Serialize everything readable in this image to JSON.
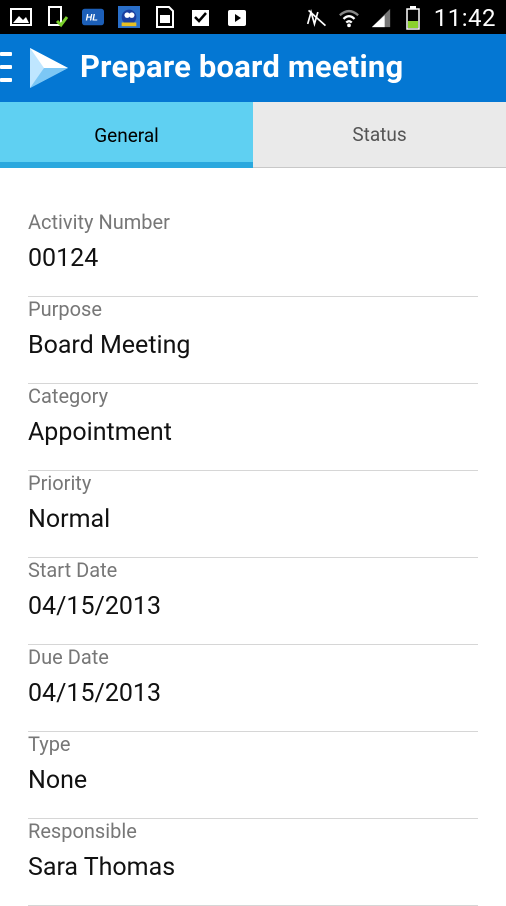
{
  "statusbar": {
    "time": "11:42",
    "icons": [
      "image-icon",
      "download-check-icon",
      "hl-app-icon",
      "sonic-app-icon",
      "sim-card-icon",
      "checkbox-icon",
      "play-store-icon"
    ],
    "right_icons": [
      "no-sound-icon",
      "wifi-icon",
      "signal-icon",
      "battery-icon"
    ]
  },
  "appbar": {
    "title": "Prepare board meeting",
    "brand_color": "#0477d3"
  },
  "tabs": {
    "general": "General",
    "status": "Status"
  },
  "fields": [
    {
      "label": "Activity Number",
      "value": "00124"
    },
    {
      "label": "Purpose",
      "value": "Board Meeting"
    },
    {
      "label": "Category",
      "value": "Appointment"
    },
    {
      "label": "Priority",
      "value": "Normal"
    },
    {
      "label": "Start Date",
      "value": "04/15/2013"
    },
    {
      "label": "Due Date",
      "value": "04/15/2013"
    },
    {
      "label": "Type",
      "value": "None"
    },
    {
      "label": "Responsible",
      "value": "Sara Thomas"
    }
  ]
}
